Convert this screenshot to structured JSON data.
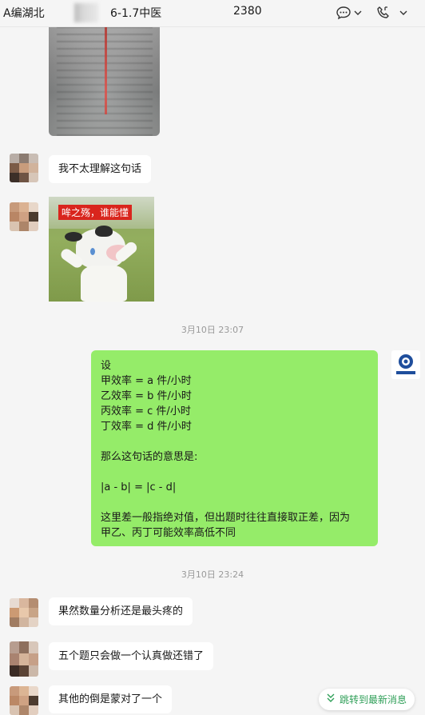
{
  "header": {
    "title_part1": "A编湖北",
    "title_part2": "6-1.7中医",
    "member_count": "2380"
  },
  "messages": {
    "m1": "我不太理解这句话",
    "meme_caption": "哞之殇，谁能懂",
    "time1": "3月10日 23:07",
    "reply_lines": [
      "设",
      "甲效率 = a 件/小时",
      "乙效率 = b 件/小时",
      "丙效率 = c 件/小时",
      "丁效率 = d 件/小时",
      "",
      "那么这句话的意思是:",
      "",
      "|a - b| = |c - d|",
      "",
      "这里差一般指绝对值，但出题时往往直接取正差，因为",
      "甲乙、丙丁可能效率高低不同"
    ],
    "time2": "3月10日 23:24",
    "m2": "果然数量分析还是最头疼的",
    "m3": "五个题只会做一个认真做还错了",
    "m4": "其他的倒是蒙对了一个"
  },
  "jump_button": "跳转到最新消息",
  "colors": {
    "self_bubble": "#95ec69",
    "other_bubble": "#ffffff",
    "background": "#f5f5f5",
    "accent_green": "#2f9f58"
  },
  "icons": [
    "chat-bubble-icon",
    "chevron-down-icon",
    "phone-call-icon",
    "double-chevron-down-icon"
  ]
}
